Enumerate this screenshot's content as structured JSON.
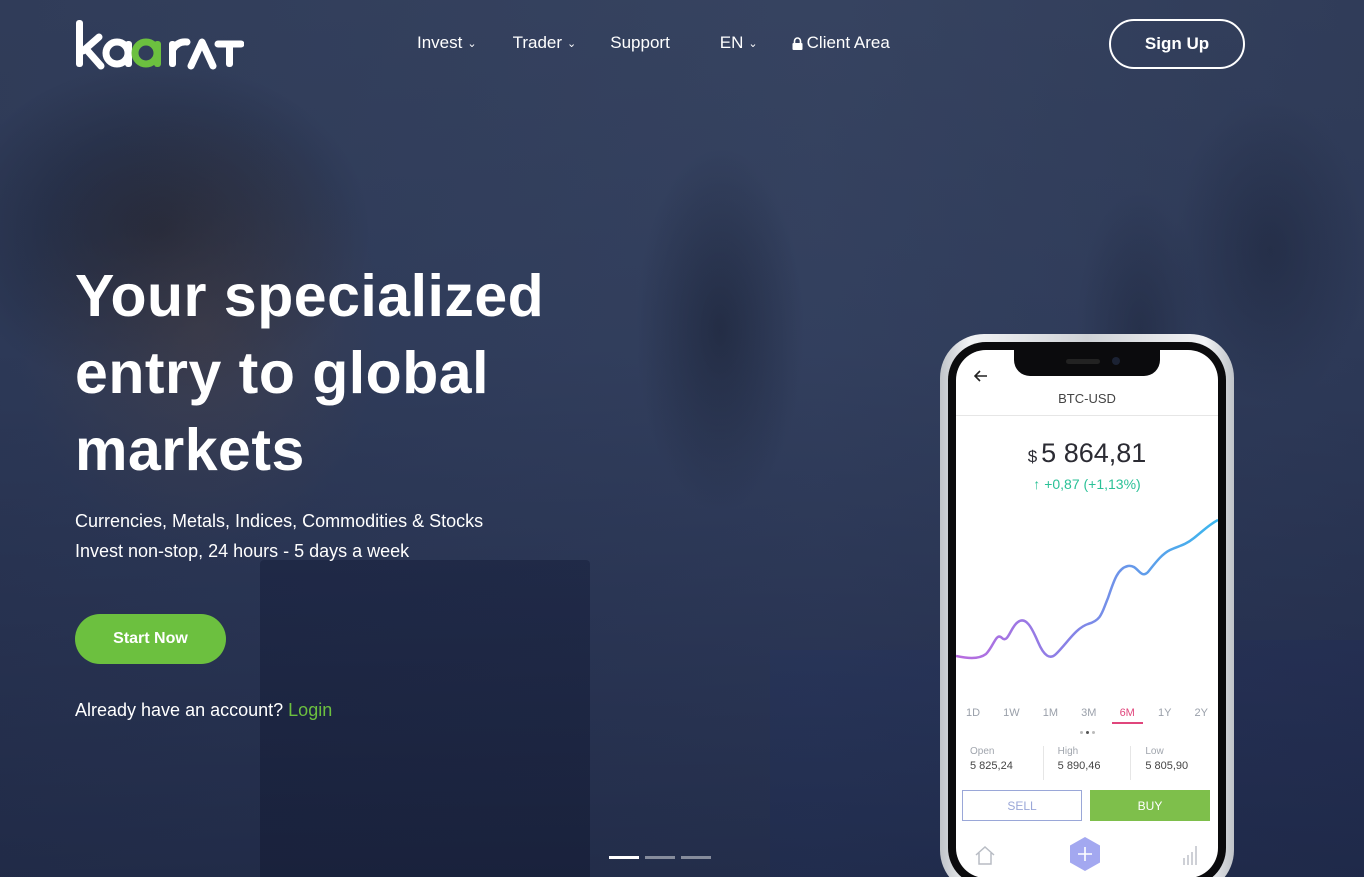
{
  "brand": {
    "name": "kaarat"
  },
  "nav": {
    "invest": "Invest",
    "trader": "Trader",
    "support": "Support",
    "language": "EN",
    "client_area": "Client Area",
    "signup": "Sign Up"
  },
  "hero": {
    "title_part1": "Your ",
    "title_bold1": "specialized",
    "title_bold2": "entry",
    "title_part2": " to global",
    "title_part3": "markets",
    "subtitle_line1": "Currencies, Metals, Indices, Commodities & Stocks",
    "subtitle_line2": "Invest non-stop, 24 hours - 5 days a week",
    "cta": "Start Now",
    "login_prompt": "Already have an account?",
    "login_link": "Login"
  },
  "slider": {
    "slides": 3,
    "active": 0
  },
  "phone": {
    "pair": "BTC-USD",
    "currency_symbol": "$",
    "price": "5 864,81",
    "change": "+0,87 (+1,13%)",
    "ranges": [
      "1D",
      "1W",
      "1M",
      "3M",
      "6M",
      "1Y",
      "2Y"
    ],
    "active_range": "6M",
    "stats": {
      "open_label": "Open",
      "open_value": "5 825,24",
      "high_label": "High",
      "high_value": "5 890,46",
      "low_label": "Low",
      "low_value": "5 805,90"
    },
    "sell": "SELL",
    "buy": "BUY"
  },
  "colors": {
    "accent_green": "#6cc03f",
    "positive": "#2bc197",
    "active_range": "#e0467c",
    "chart_start": "#b96bdf",
    "chart_end": "#3ab7ee"
  }
}
